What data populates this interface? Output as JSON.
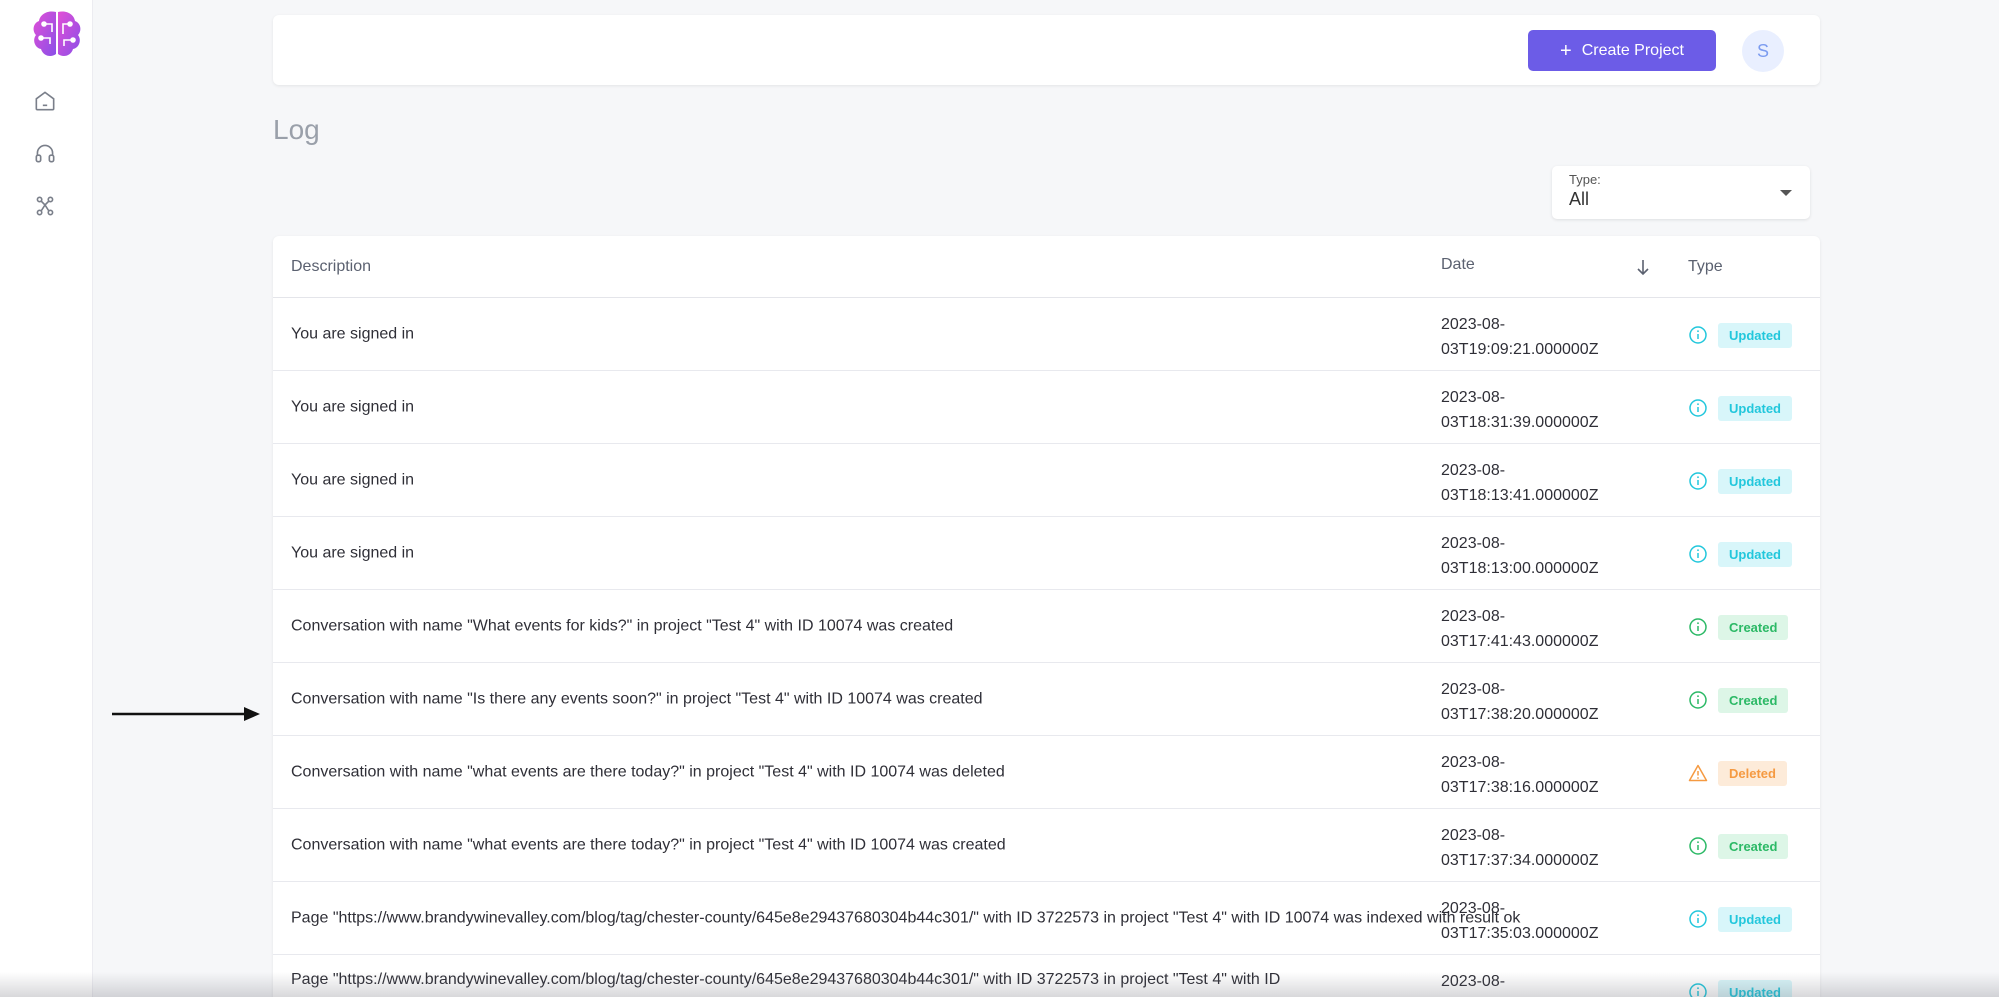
{
  "topbar": {
    "create_label": "Create Project",
    "avatar_initial": "S"
  },
  "page": {
    "title": "Log"
  },
  "filter": {
    "label": "Type:",
    "value": "All"
  },
  "table": {
    "headers": {
      "description": "Description",
      "date": "Date",
      "type": "Type"
    },
    "rows": [
      {
        "description": "You are signed in",
        "date": "2023-08-\n03T19:09:21.000000Z",
        "type": "Updated"
      },
      {
        "description": "You are signed in",
        "date": "2023-08-\n03T18:31:39.000000Z",
        "type": "Updated"
      },
      {
        "description": "You are signed in",
        "date": "2023-08-\n03T18:13:41.000000Z",
        "type": "Updated"
      },
      {
        "description": "You are signed in",
        "date": "2023-08-\n03T18:13:00.000000Z",
        "type": "Updated"
      },
      {
        "description": "Conversation with name \"What events for kids?\" in project \"Test 4\" with ID 10074 was created",
        "date": "2023-08-\n03T17:41:43.000000Z",
        "type": "Created"
      },
      {
        "description": "Conversation with name \"Is there any events soon?\" in project \"Test 4\" with ID 10074 was created",
        "date": "2023-08-\n03T17:38:20.000000Z",
        "type": "Created"
      },
      {
        "description": "Conversation with name \"what events are there today?\" in project \"Test 4\" with ID 10074 was deleted",
        "date": "2023-08-\n03T17:38:16.000000Z",
        "type": "Deleted"
      },
      {
        "description": "Conversation with name \"what events are there today?\" in project \"Test 4\" with ID 10074 was created",
        "date": "2023-08-\n03T17:37:34.000000Z",
        "type": "Created"
      },
      {
        "description": "Page \"https://www.brandywinevalley.com/blog/tag/chester-county/645e8e29437680304b44c301/\" with ID 3722573 in project \"Test 4\" with ID 10074 was indexed with result ok",
        "date": "2023-08-\n03T17:35:03.000000Z",
        "type": "Updated"
      },
      {
        "description": "Page \"https://www.brandywinevalley.com/blog/tag/chester-county/645e8e29437680304b44c301/\" with ID 3722573 in project \"Test 4\" with ID",
        "date": "2023-08-",
        "type": "Updated"
      }
    ]
  },
  "colors": {
    "accent": "#6c5ce7",
    "updated": "#22c7dc",
    "created": "#2cb966",
    "deleted": "#f59a42"
  }
}
